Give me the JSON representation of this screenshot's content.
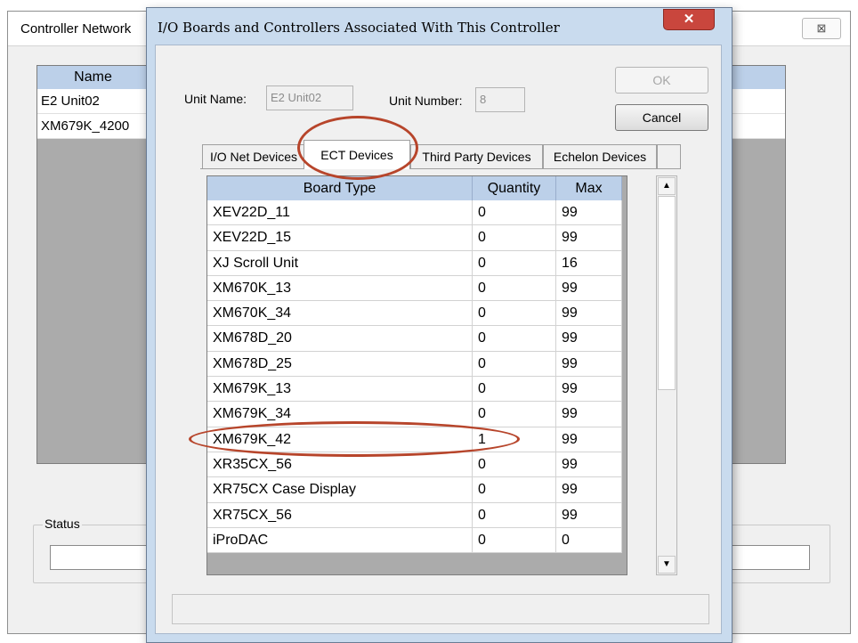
{
  "background_window": {
    "title": "Controller Network",
    "close_glyph": "⊠",
    "list_header": "Name",
    "rows": [
      "E2 Unit02",
      "XM679K_4200"
    ],
    "status_label": "Status"
  },
  "dialog": {
    "title": "I/O Boards and Controllers Associated With This Controller",
    "close_glyph": "✕",
    "unit_name_label": "Unit Name:",
    "unit_name_value": "E2 Unit02",
    "unit_number_label": "Unit Number:",
    "unit_number_value": "8",
    "ok_label": "OK",
    "cancel_label": "Cancel",
    "tabs": [
      {
        "label": "I/O Net Devices",
        "active": false
      },
      {
        "label": "ECT Devices",
        "active": true
      },
      {
        "label": "Third Party Devices",
        "active": false
      },
      {
        "label": "Echelon Devices",
        "active": false
      }
    ],
    "grid": {
      "columns": [
        "Board Type",
        "Quantity",
        "Max"
      ],
      "rows": [
        {
          "board_type": "XEV22D_11",
          "quantity": "0",
          "max": "99"
        },
        {
          "board_type": "XEV22D_15",
          "quantity": "0",
          "max": "99"
        },
        {
          "board_type": "XJ Scroll Unit",
          "quantity": "0",
          "max": "16"
        },
        {
          "board_type": "XM670K_13",
          "quantity": "0",
          "max": "99"
        },
        {
          "board_type": "XM670K_34",
          "quantity": "0",
          "max": "99"
        },
        {
          "board_type": "XM678D_20",
          "quantity": "0",
          "max": "99"
        },
        {
          "board_type": "XM678D_25",
          "quantity": "0",
          "max": "99"
        },
        {
          "board_type": "XM679K_13",
          "quantity": "0",
          "max": "99"
        },
        {
          "board_type": "XM679K_34",
          "quantity": "0",
          "max": "99"
        },
        {
          "board_type": "XM679K_42",
          "quantity": "1",
          "max": "99"
        },
        {
          "board_type": "XR35CX_56",
          "quantity": "0",
          "max": "99"
        },
        {
          "board_type": "XR75CX Case Display",
          "quantity": "0",
          "max": "99"
        },
        {
          "board_type": "XR75CX_56",
          "quantity": "0",
          "max": "99"
        },
        {
          "board_type": "iProDAC",
          "quantity": "0",
          "max": "0"
        }
      ]
    },
    "scroll_up_glyph": "▲",
    "scroll_down_glyph": "▼"
  },
  "colors": {
    "highlight_oval": "#b7452b",
    "grid_header": "#bcd0e9",
    "dialog_frame": "#c9dbee",
    "close_button": "#c9463d"
  }
}
